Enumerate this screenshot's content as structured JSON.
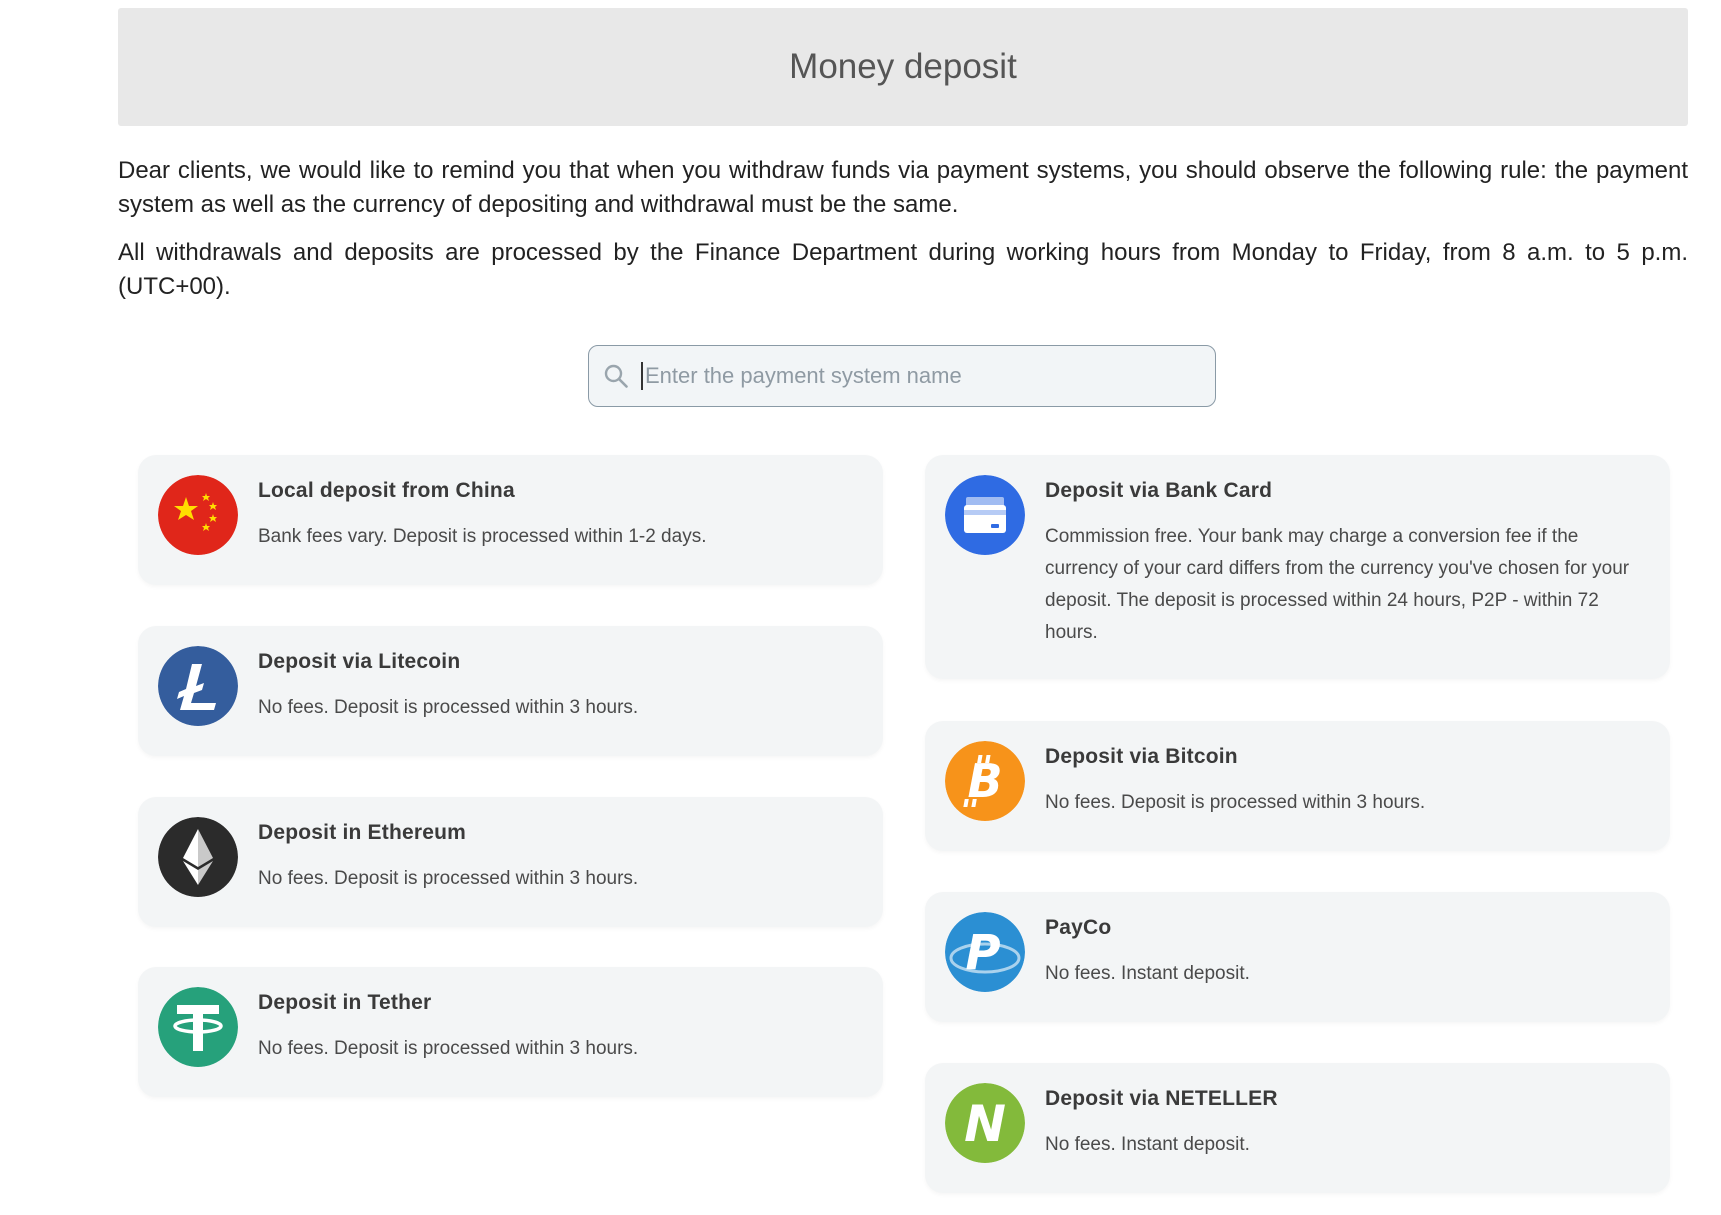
{
  "header": {
    "title": "Money deposit"
  },
  "notice": {
    "paragraph1": "Dear clients, we would like to remind you that when you withdraw funds via payment systems, you should observe the following rule: the payment system as well as the currency of depositing and withdrawal must be the same.",
    "paragraph2": "All withdrawals and deposits are processed by the Finance Department during working hours from Monday to Friday, from 8 a.m. to 5 p.m. (UTC+00)."
  },
  "search": {
    "placeholder": "Enter the payment system name",
    "value": ""
  },
  "methods": {
    "left": [
      {
        "icon": "china-flag-icon",
        "title": "Local deposit from China",
        "desc": "Bank fees vary. Deposit is processed within 1-2 days.",
        "color": "#e0261a"
      },
      {
        "icon": "litecoin-icon",
        "title": "Deposit via Litecoin",
        "desc": "No fees. Deposit is processed within 3 hours.",
        "color": "#345d9d"
      },
      {
        "icon": "ethereum-icon",
        "title": "Deposit in Ethereum",
        "desc": "No fees. Deposit is processed within 3 hours.",
        "color": "#2b2b2b"
      },
      {
        "icon": "tether-icon",
        "title": "Deposit in Tether",
        "desc": "No fees. Deposit is processed within 3 hours.",
        "color": "#26a17b"
      }
    ],
    "right": [
      {
        "icon": "bank-card-icon",
        "title": "Deposit via Bank Card",
        "desc": "Commission free. Your bank may charge a conversion fee if the currency of your card differs from the currency you've chosen for your deposit. The deposit is processed within 24 hours, P2P - within 72 hours.",
        "color": "#2f6be3"
      },
      {
        "icon": "bitcoin-icon",
        "title": "Deposit via Bitcoin",
        "desc": "No fees. Deposit is processed within 3 hours.",
        "color": "#f7931a"
      },
      {
        "icon": "payco-icon",
        "title": "PayCo",
        "desc": "No fees. Instant deposit.",
        "color": "#2b8fd3"
      },
      {
        "icon": "neteller-icon",
        "title": "Deposit via NETELLER",
        "desc": "No fees. Instant deposit.",
        "color": "#83ba3b"
      }
    ]
  }
}
